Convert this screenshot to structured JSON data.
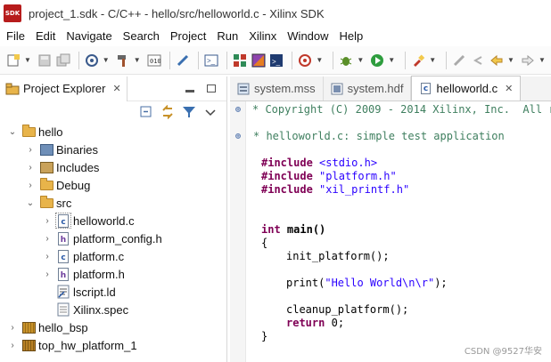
{
  "window": {
    "title": "project_1.sdk - C/C++ - hello/src/helloworld.c - Xilinx SDK",
    "logo_text": "SDK"
  },
  "menu": [
    "File",
    "Edit",
    "Navigate",
    "Search",
    "Project",
    "Run",
    "Xilinx",
    "Window",
    "Help"
  ],
  "project_explorer": {
    "tab_label": "Project Explorer",
    "tree": [
      {
        "label": "hello",
        "icon": "project-icon",
        "twisty": "expanded"
      },
      {
        "label": "Binaries",
        "icon": "binaries-icon",
        "twisty": "collapsed"
      },
      {
        "label": "Includes",
        "icon": "includes-icon",
        "twisty": "collapsed"
      },
      {
        "label": "Debug",
        "icon": "folder-icon",
        "twisty": "collapsed"
      },
      {
        "label": "src",
        "icon": "folder-icon",
        "twisty": "expanded"
      },
      {
        "label": "helloworld.c",
        "icon": "c-file-icon",
        "twisty": "collapsed",
        "selected": true
      },
      {
        "label": "platform_config.h",
        "icon": "h-file-icon",
        "twisty": "collapsed"
      },
      {
        "label": "platform.c",
        "icon": "c-file-icon",
        "twisty": "collapsed"
      },
      {
        "label": "platform.h",
        "icon": "h-file-icon",
        "twisty": "collapsed"
      },
      {
        "label": "lscript.ld",
        "icon": "linker-script-icon",
        "twisty": "none"
      },
      {
        "label": "Xilinx.spec",
        "icon": "spec-file-icon",
        "twisty": "none"
      },
      {
        "label": "hello_bsp",
        "icon": "bsp-icon",
        "twisty": "collapsed"
      },
      {
        "label": "top_hw_platform_1",
        "icon": "hw-platform-icon",
        "twisty": "collapsed"
      }
    ]
  },
  "editor": {
    "tabs": [
      {
        "label": "system.mss",
        "icon": "mss-file-icon",
        "active": false
      },
      {
        "label": "system.hdf",
        "icon": "hdf-file-icon",
        "active": false
      },
      {
        "label": "helloworld.c",
        "icon": "c-file-icon",
        "active": true
      }
    ],
    "code": {
      "copyright": "* Copyright (C) 2009 - 2014 Xilinx, Inc.  All r",
      "header_comment": "* helloworld.c: simple test application",
      "include1_kw": "#include",
      "include1_file": "<stdio.h>",
      "include2_kw": "#include",
      "include2_file": "\"platform.h\"",
      "include3_kw": "#include",
      "include3_file": "\"xil_printf.h\"",
      "main_kw": "int",
      "main_sig": "main()",
      "open_brace": "{",
      "init_call": "init_platform();",
      "print_fn": "print(",
      "print_str": "\"Hello World\\n\\r\"",
      "print_end": ");",
      "cleanup_call": "cleanup_platform();",
      "return_kw": "return",
      "return_val": "0;",
      "close_brace": "}"
    }
  },
  "watermark": "CSDN @9527华安"
}
